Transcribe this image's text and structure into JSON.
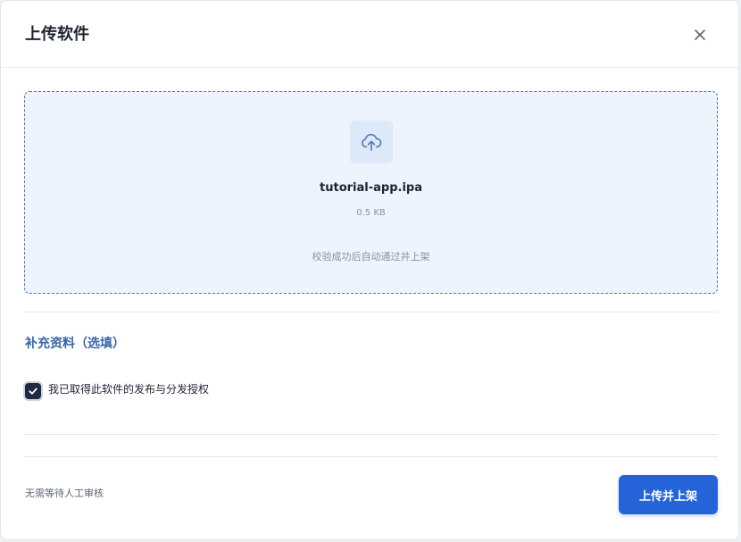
{
  "dialog": {
    "title": "上传软件",
    "close_icon": "close-icon"
  },
  "dropzone": {
    "icon": "cloud-upload-icon",
    "file_name": "tutorial-app.ipa",
    "file_size": "0.5 KB",
    "hint": "校验成功后自动通过并上架"
  },
  "supplement": {
    "title": "补充资料（选填）",
    "checkbox_checked": true,
    "checkbox_label": "我已取得此软件的发布与分发授权"
  },
  "footer": {
    "note": "无需等待人工审核",
    "submit_label": "上传并上架"
  },
  "colors": {
    "primary": "#2563d9",
    "section_title": "#3b66a8",
    "dropzone_bg": "#eef4fd",
    "dropzone_border": "#4f78b8",
    "checkbox": "#1e2a3f"
  }
}
